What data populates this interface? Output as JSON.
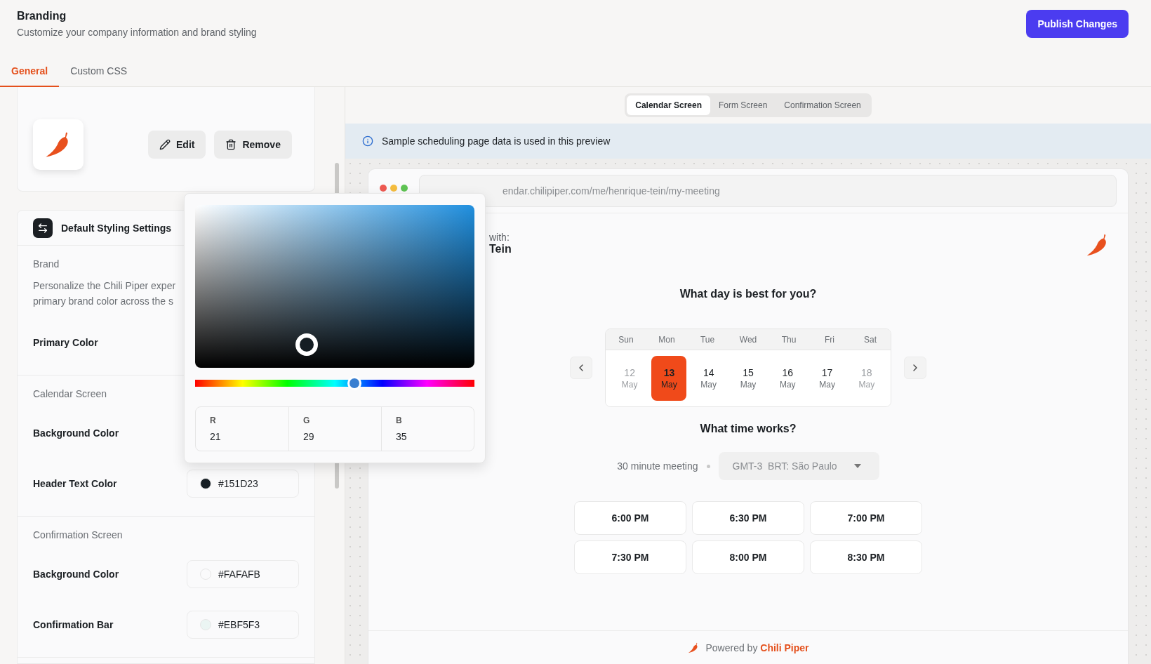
{
  "header": {
    "title": "Branding",
    "subtitle": "Customize your company information and brand styling",
    "publish_button": "Publish Changes"
  },
  "tabs": [
    {
      "label": "General",
      "selected": true
    },
    {
      "label": "Custom CSS",
      "selected": false
    }
  ],
  "logo_card": {
    "edit_button": "Edit",
    "remove_button": "Remove"
  },
  "styling_card": {
    "title": "Default Styling Settings",
    "sections": [
      {
        "heading": "Brand",
        "description": "Personalize the Chili Piper exper\nprimary brand color across the s",
        "rows": [
          {
            "label": "Primary Color"
          }
        ]
      },
      {
        "heading": "Calendar Screen",
        "rows": [
          {
            "label": "Background Color"
          },
          {
            "label": "Header Text Color",
            "value": "#151D23",
            "color": "#151d23"
          }
        ]
      },
      {
        "heading": "Confirmation Screen",
        "rows": [
          {
            "label": "Background Color",
            "value": "#FAFAFB",
            "color": "#fafafb"
          },
          {
            "label": "Confirmation Bar",
            "value": "#EBF5F3",
            "color": "#ebf5f3"
          }
        ]
      }
    ]
  },
  "color_picker": {
    "level": 0.57,
    "channels": [
      {
        "label": "R",
        "value": "21"
      },
      {
        "label": "G",
        "value": "29"
      },
      {
        "label": "B",
        "value": "35"
      }
    ]
  },
  "preview": {
    "segments": [
      {
        "label": "Calendar Screen",
        "selected": true
      },
      {
        "label": "Form Screen",
        "selected": false
      },
      {
        "label": "Confirmation Screen",
        "selected": false
      }
    ],
    "info": "Sample scheduling page data is used in this preview",
    "url": "endar.chilipiper.com/me/henrique-tein/my-meeting",
    "host_label": "with:",
    "host_name": "Tein",
    "day_heading": "What day is best for you?",
    "days": [
      {
        "weekday": "Sun",
        "date": "12",
        "month": "May",
        "selected": false,
        "disabled": true
      },
      {
        "weekday": "Mon",
        "date": "13",
        "month": "May",
        "selected": true,
        "disabled": false
      },
      {
        "weekday": "Tue",
        "date": "14",
        "month": "May",
        "selected": false,
        "disabled": false
      },
      {
        "weekday": "Wed",
        "date": "15",
        "month": "May",
        "selected": false,
        "disabled": false
      },
      {
        "weekday": "Thu",
        "date": "16",
        "month": "May",
        "selected": false,
        "disabled": false
      },
      {
        "weekday": "Fri",
        "date": "17",
        "month": "May",
        "selected": false,
        "disabled": false
      },
      {
        "weekday": "Sat",
        "date": "18",
        "month": "May",
        "selected": false,
        "disabled": true
      }
    ],
    "time_heading": "What time works?",
    "duration": "30 minute meeting",
    "timezone": "GMT-3  BRT: São Paulo",
    "times": [
      "6:00 PM",
      "6:30 PM",
      "7:00 PM",
      "7:30 PM",
      "8:00 PM",
      "8:30 PM"
    ],
    "footer": {
      "prefix": "Powered by",
      "brand": "Chili Piper"
    }
  }
}
